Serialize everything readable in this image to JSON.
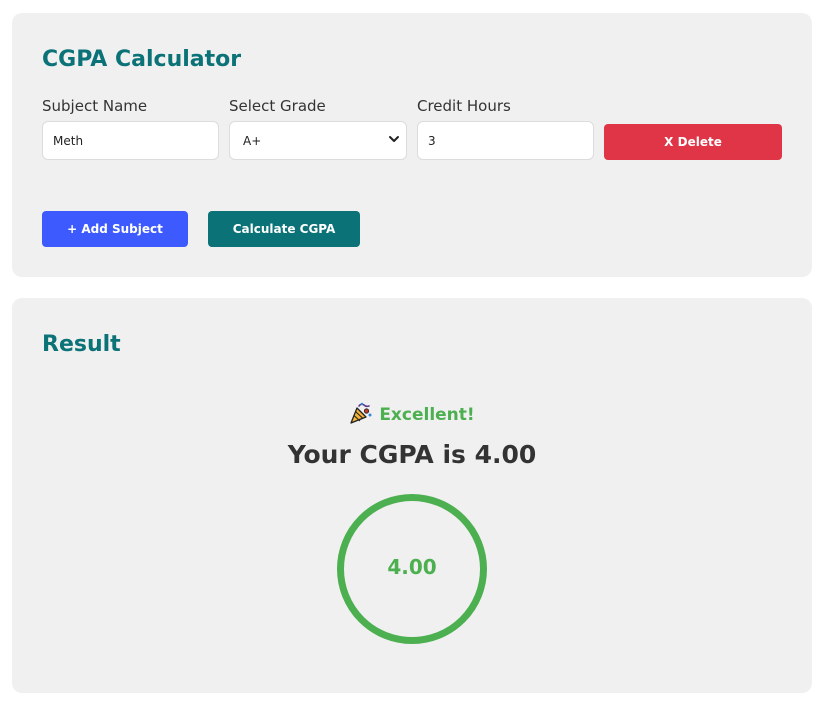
{
  "calculator": {
    "title": "CGPA Calculator",
    "labels": {
      "subject": "Subject Name",
      "grade": "Select Grade",
      "credits": "Credit Hours"
    },
    "subject_row": {
      "subject_value": "Meth",
      "grade_value": "A+",
      "credits_value": "3",
      "delete_label": "X Delete"
    },
    "add_label": "+ Add Subject",
    "calculate_label": "Calculate CGPA"
  },
  "result": {
    "title": "Result",
    "status": "Excellent!",
    "status_icon": "party-popper-icon",
    "cgpa_text": "Your CGPA is 4.00",
    "cgpa_value": "4.00"
  },
  "colors": {
    "accent_teal": "#0b7277",
    "danger": "#e03546",
    "primary": "#3d5afe",
    "success": "#4caf50"
  }
}
